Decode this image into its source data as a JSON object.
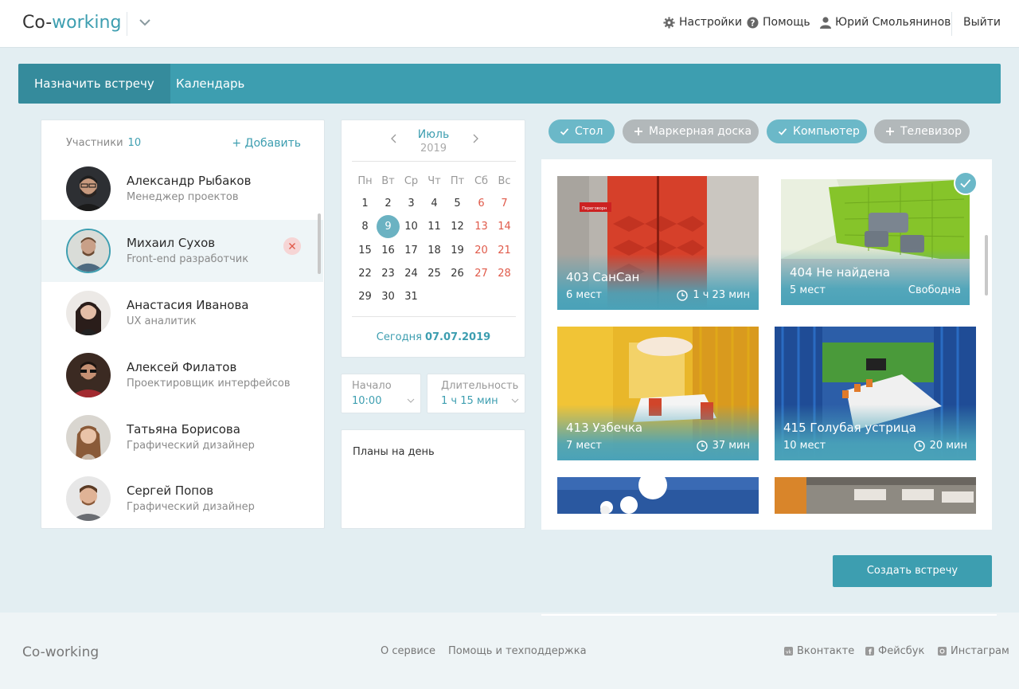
{
  "header": {
    "logo_prefix": "Co-",
    "logo_accent": "working",
    "settings": "Настройки",
    "help": "Помощь",
    "user": "Юрий Смольянинов",
    "logout": "Выйти"
  },
  "tabs": [
    "Назначить встречу",
    "Календарь"
  ],
  "participants": {
    "label": "Участники",
    "count": "10",
    "add": "+ Добавить",
    "list": [
      {
        "name": "Александр Рыбаков",
        "role": "Менеджер проектов"
      },
      {
        "name": "Михаил Сухов",
        "role": "Front-end разработчик"
      },
      {
        "name": "Анастасия Иванова",
        "role": "UX аналитик"
      },
      {
        "name": "Алексей Филатов",
        "role": "Проектировщик интерфейсов"
      },
      {
        "name": "Татьяна Борисова",
        "role": "Графический дизайнер"
      },
      {
        "name": "Сергей Попов",
        "role": "Графический дизайнер"
      }
    ]
  },
  "calendar": {
    "month": "Июль",
    "year": "2019",
    "weekdays": [
      "Пн",
      "Вт",
      "Ср",
      "Чт",
      "Пт",
      "Сб",
      "Вс"
    ],
    "days": [
      "1",
      "2",
      "3",
      "4",
      "5",
      "6",
      "7",
      "8",
      "9",
      "10",
      "11",
      "12",
      "13",
      "14",
      "15",
      "16",
      "17",
      "18",
      "19",
      "20",
      "21",
      "22",
      "23",
      "24",
      "25",
      "26",
      "27",
      "28",
      "29",
      "30",
      "31"
    ],
    "selected_day": "9",
    "today_label": "Сегодня",
    "today_date": "07.07.2019"
  },
  "start": {
    "label": "Начало",
    "value": "10:00"
  },
  "duration": {
    "label": "Длительность",
    "value": "1 ч 15 мин"
  },
  "plans": {
    "label": "Планы на день"
  },
  "filters": [
    {
      "label": "Стол",
      "active": true
    },
    {
      "label": "Маркерная доска",
      "active": false
    },
    {
      "label": "Компьютер",
      "active": true
    },
    {
      "label": "Телевизор",
      "active": false
    }
  ],
  "rooms": [
    {
      "name": "403 СанСан",
      "seats": "6 мест",
      "status": "1 ч 23 мин",
      "selected": false
    },
    {
      "name": "404 Не найдена",
      "seats": "5 мест",
      "status": "Свободна",
      "selected": true
    },
    {
      "name": "413 Узбечка",
      "seats": "7 мест",
      "status": "37 мин",
      "selected": false
    },
    {
      "name": "415 Голубая устрица",
      "seats": "10 мест",
      "status": "20 мин",
      "selected": false
    }
  ],
  "create_button": "Создать встречу",
  "footer": {
    "logo": "Co-working",
    "about": "О сервисе",
    "support": "Помощь и техподдержка",
    "vk": "Вконтакте",
    "fb": "Фейсбук",
    "ig": "Инстаграм"
  },
  "colors": {
    "accent": "#3d9eb0",
    "weekend": "#e05a4a",
    "chip_off": "#b2b8ba"
  }
}
